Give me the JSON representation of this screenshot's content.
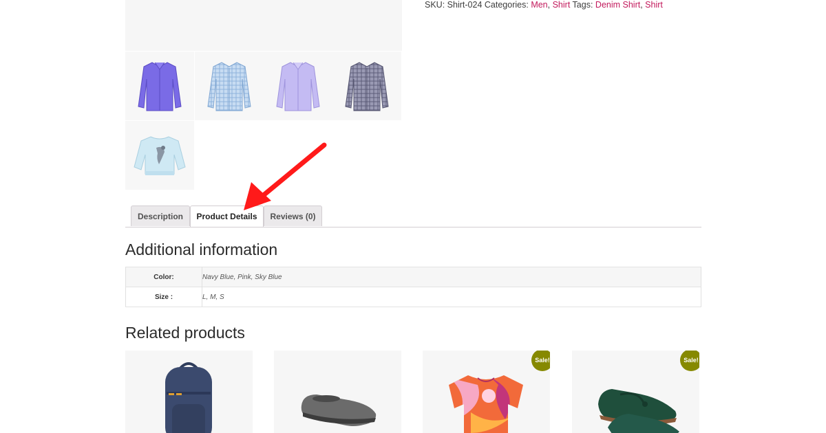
{
  "product_meta": {
    "sku_label": "SKU:",
    "sku": "Shirt-024",
    "categories_label": "Categories:",
    "categories": [
      "Men",
      "Shirt"
    ],
    "tags_label": "Tags:",
    "tags": [
      "Denim Shirt",
      "Shirt"
    ],
    "separator": ", "
  },
  "tabs": [
    {
      "label": "Description",
      "active": false
    },
    {
      "label": "Product Details",
      "active": true
    },
    {
      "label": "Reviews (0)",
      "active": false
    }
  ],
  "additional_info": {
    "title": "Additional information",
    "rows": [
      {
        "label": "Color:",
        "value": "Navy Blue, Pink, Sky Blue"
      },
      {
        "label": "Size :",
        "value": "L, M, S"
      }
    ]
  },
  "related": {
    "title": "Related products",
    "sale_badge": "Sale!",
    "items": [
      {
        "icon": "backpack-icon",
        "sale": false
      },
      {
        "icon": "slipper-icon",
        "sale": false
      },
      {
        "icon": "patterned-blouse-icon",
        "sale": true
      },
      {
        "icon": "loafer-icon",
        "sale": true
      }
    ]
  },
  "gallery": {
    "thumbnails": [
      {
        "icon": "purple-shirt-icon"
      },
      {
        "icon": "light-blue-check-shirt-icon"
      },
      {
        "icon": "lavender-shirt-icon"
      },
      {
        "icon": "grey-check-shirt-icon"
      },
      {
        "icon": "kids-sweatshirt-icon"
      }
    ]
  },
  "colors": {
    "link": "#c2185b",
    "sale_badge": "#868900",
    "annotation_arrow": "#ff1a1a",
    "tab_inactive_bg": "#ebe9eb"
  }
}
